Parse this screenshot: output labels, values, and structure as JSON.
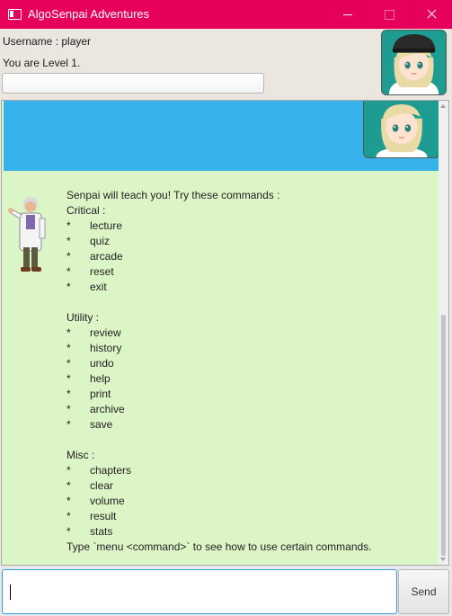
{
  "window": {
    "title": "AlgoSenpai Adventures"
  },
  "header": {
    "username": "Username : player",
    "level": "You are Level 1.",
    "progress_fraction": 0
  },
  "bot_message": {
    "intro": "Senpai will teach you! Try these commands :",
    "sections": [
      {
        "heading": "Critical :",
        "items": [
          "lecture",
          "quiz",
          "arcade",
          "reset",
          "exit"
        ]
      },
      {
        "heading": "Utility :",
        "items": [
          "review",
          "history",
          "undo",
          "help",
          "print",
          "archive",
          "save"
        ]
      },
      {
        "heading": "Misc :",
        "items": [
          "chapters",
          "clear",
          "volume",
          "result",
          "stats"
        ]
      }
    ],
    "bullet": "*",
    "footer": "Type `menu <command>` to see how to use certain commands."
  },
  "input": {
    "value": "",
    "placeholder": ""
  },
  "send_label": "Send",
  "colors": {
    "titlebar": "#e6005c",
    "user_bubble": "#37b2ea",
    "bot_bubble": "#dcf5c6",
    "avatar_bg": "#1f9c92"
  },
  "icons": {
    "app": "window-icon",
    "user_avatar": "user-avatar-icon",
    "bot_avatar": "professor-avatar-icon"
  }
}
